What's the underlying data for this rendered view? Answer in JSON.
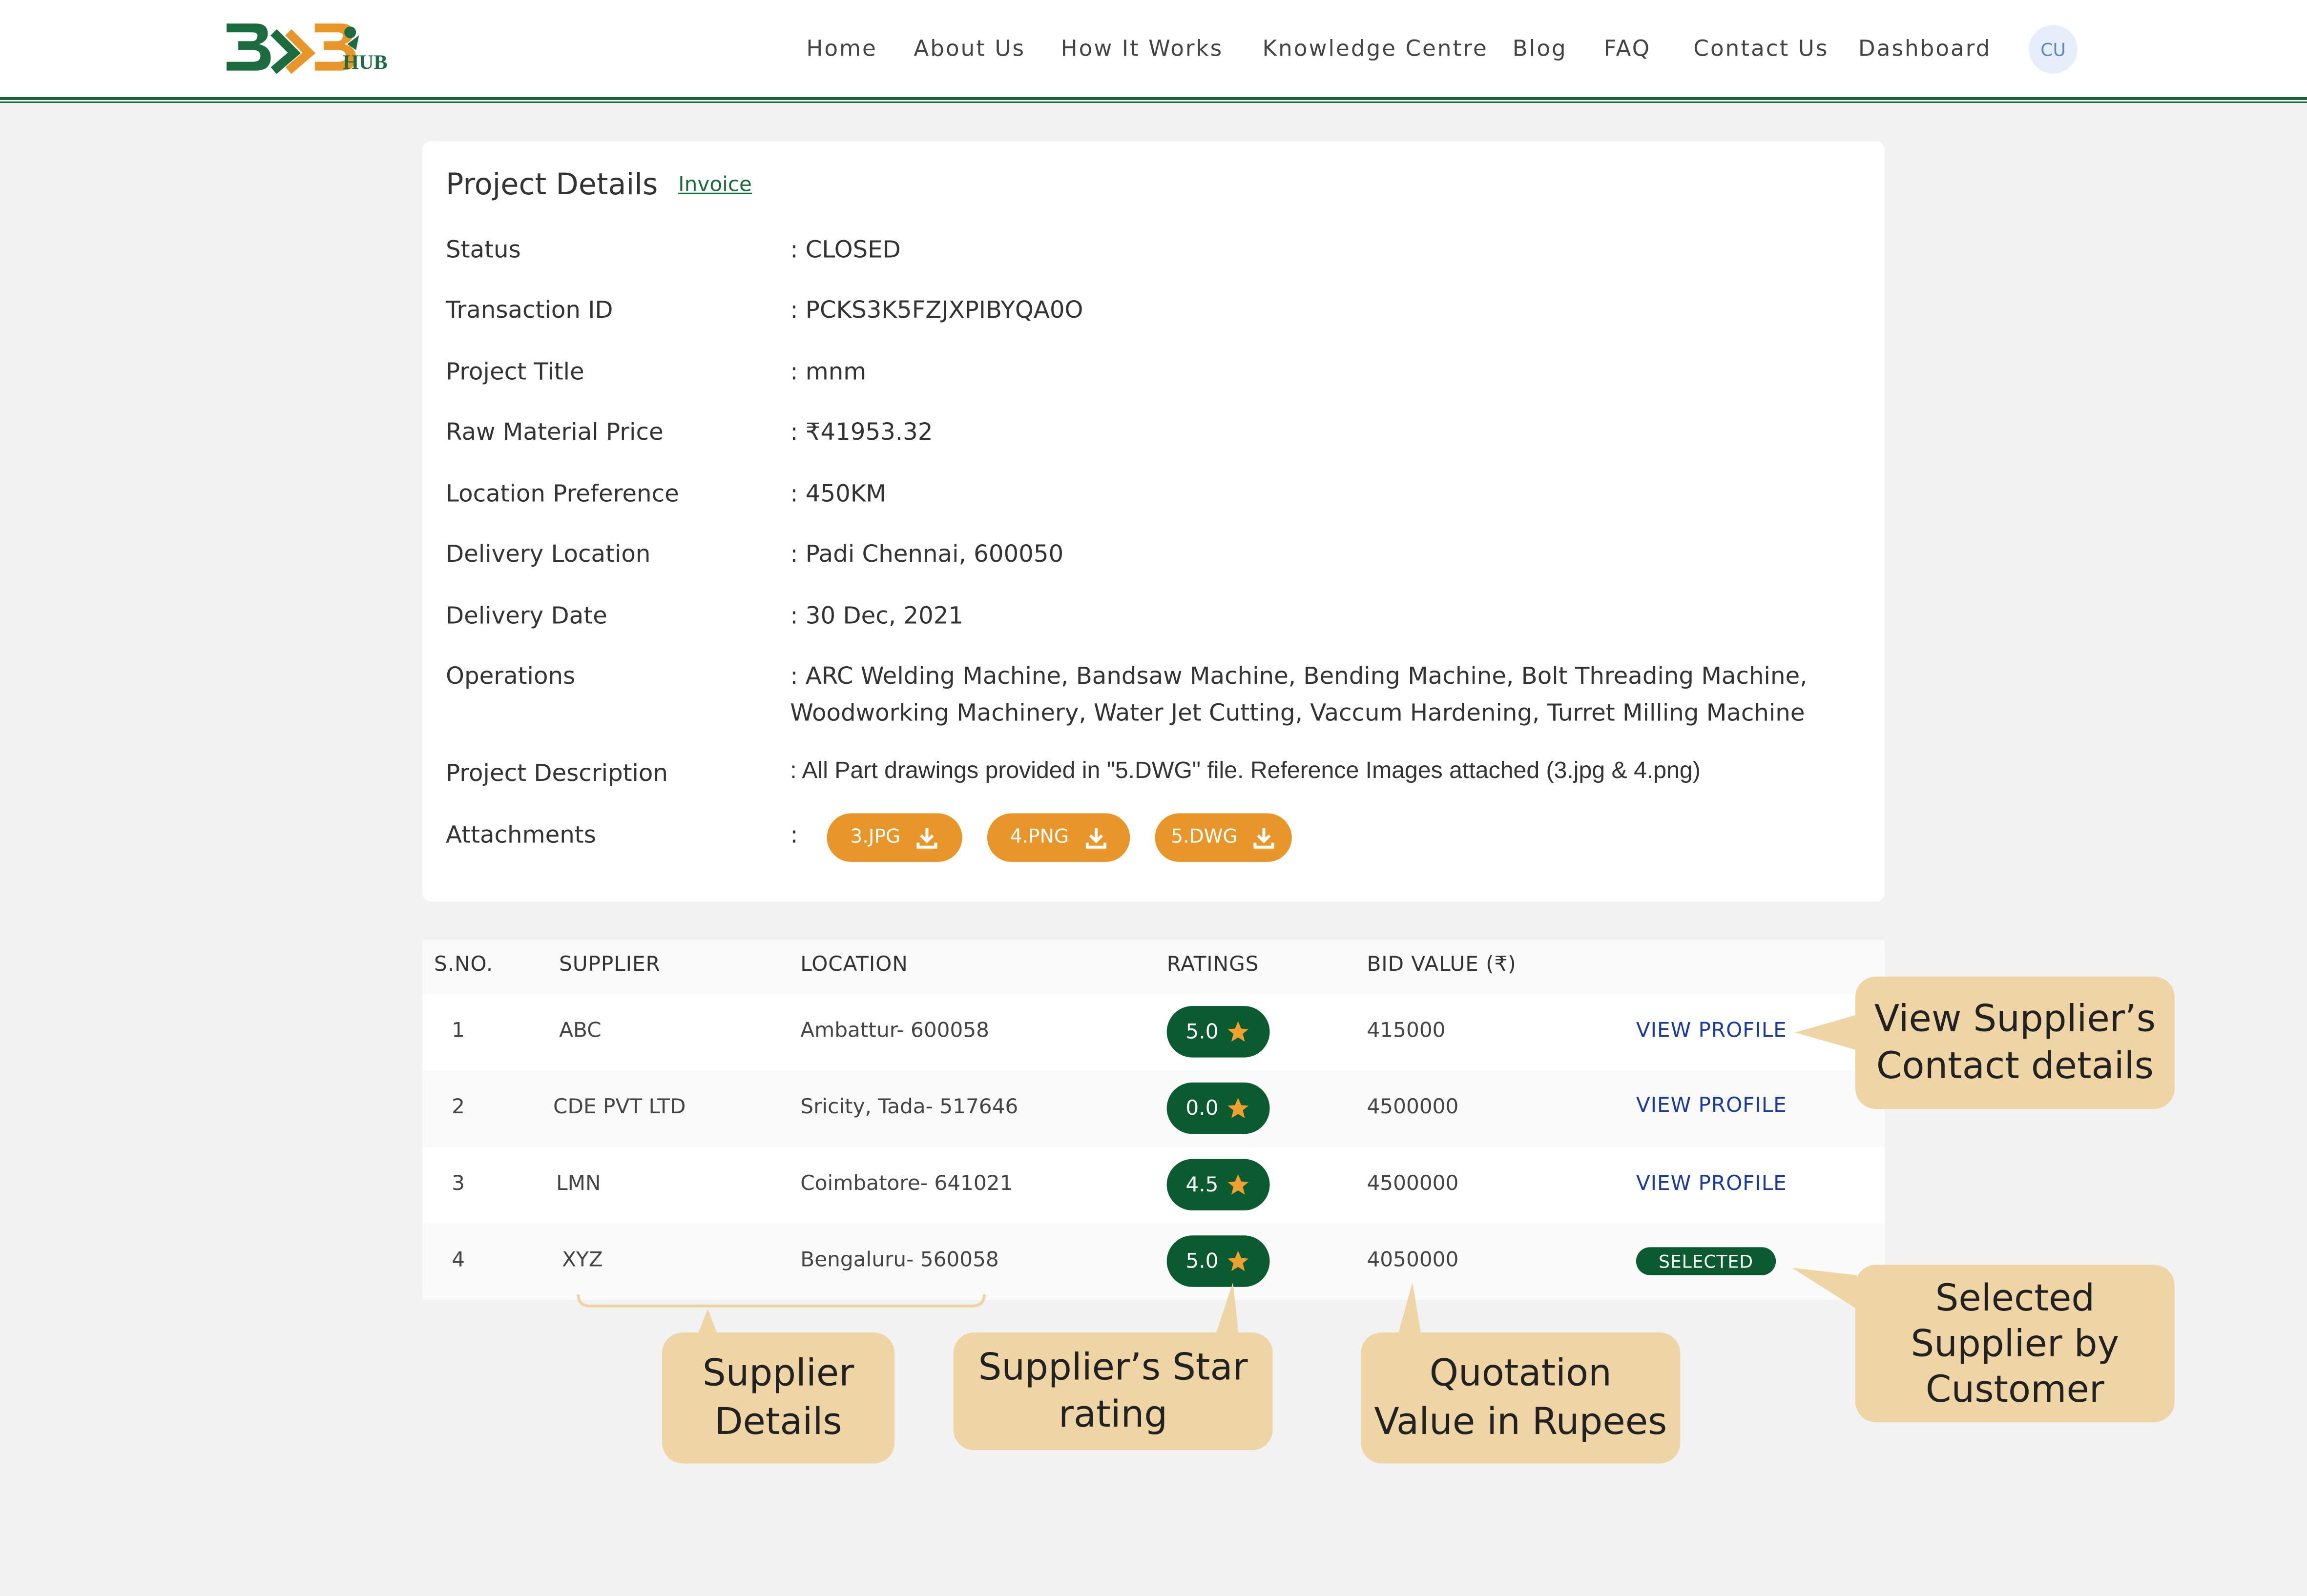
{
  "header": {
    "logo_text": "B2B HUB",
    "nav": [
      "Home",
      "About Us",
      "How It Works",
      "Knowledge Centre",
      "Blog",
      "FAQ",
      "Contact Us",
      "Dashboard"
    ],
    "avatar_initials": "CU"
  },
  "project": {
    "title": "Project Details",
    "invoice_link": "Invoice",
    "fields": [
      {
        "label": "Status",
        "value": ": CLOSED"
      },
      {
        "label": "Transaction ID",
        "value": ": PCKS3K5FZJXPIBYQA0O"
      },
      {
        "label": "Project Title",
        "value": ": mnm"
      },
      {
        "label": "Raw Material Price",
        "value": ": ₹41953.32"
      },
      {
        "label": "Location Preference",
        "value": ": 450KM"
      },
      {
        "label": "Delivery Location",
        "value": ": Padi Chennai, 600050"
      },
      {
        "label": "Delivery Date",
        "value": ": 30 Dec, 2021"
      },
      {
        "label": "Operations",
        "value": ": ARC Welding Machine, Bandsaw Machine, Bending Machine, Bolt Threading Machine,",
        "value_line2": "Woodworking Machinery, Water Jet Cutting, Vaccum Hardening, Turret Milling Machine"
      },
      {
        "label": "Project Description",
        "value": ": All Part drawings provided in \"5.DWG\" file. Reference Images attached (3.jpg & 4.png)"
      },
      {
        "label": "Attachments",
        "value": ":"
      }
    ],
    "attachments": [
      "3.JPG",
      "4.PNG",
      "5.DWG"
    ]
  },
  "table": {
    "headers": [
      "S.NO.",
      "SUPPLIER",
      "LOCATION",
      "RATINGS",
      "BID VALUE (₹)"
    ],
    "rows": [
      {
        "sno": "1",
        "supplier": "ABC",
        "location": "Ambattur- 600058",
        "rating": "5.0",
        "bid": "415000",
        "action": "VIEW PROFILE"
      },
      {
        "sno": "2",
        "supplier": "CDE PVT LTD",
        "location": "Sricity, Tada- 517646",
        "rating": "0.0",
        "bid": "4500000",
        "action": "VIEW PROFILE"
      },
      {
        "sno": "3",
        "supplier": "LMN",
        "location": "Coimbatore- 641021",
        "rating": "4.5",
        "bid": "4500000",
        "action": "VIEW PROFILE"
      },
      {
        "sno": "4",
        "supplier": "XYZ",
        "location": "Bengaluru- 560058",
        "rating": "5.0",
        "bid": "4050000",
        "action": "SELECTED"
      }
    ]
  },
  "callouts": {
    "view_profile": [
      "View Supplier’s",
      "Contact details"
    ],
    "selected": [
      "Selected",
      "Supplier by",
      "Customer"
    ],
    "supplier_details": [
      "Supplier",
      "Details"
    ],
    "star_rating": [
      "Supplier’s Star",
      "rating"
    ],
    "quotation": [
      "Quotation",
      "Value in Rupees"
    ]
  },
  "colors": {
    "brand_green": "#0b5a30",
    "accent_orange": "#e8962a",
    "link_blue": "#1a3a9c",
    "callout_bg": "#efd5a6",
    "page_bg": "#f2f2f2"
  }
}
